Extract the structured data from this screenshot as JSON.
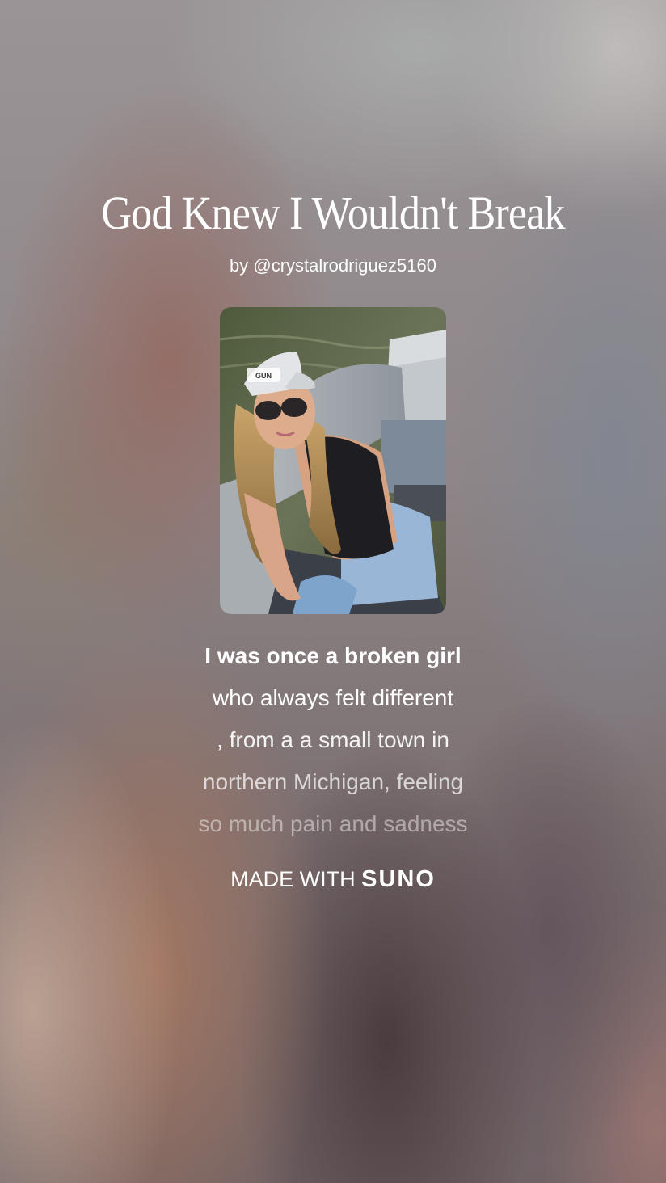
{
  "song": {
    "title": "God Knew I Wouldn't Break",
    "byline": "by @crystalrodriguez5160"
  },
  "cover": {
    "cap_text": "GUN"
  },
  "lyrics": {
    "lines": [
      "I was once a broken girl",
      "who always felt different",
      ", from a a small town in",
      "northern Michigan, feeling",
      "so much pain and sadness"
    ]
  },
  "footer": {
    "made_with": "MADE WITH",
    "brand": "SUNO"
  }
}
